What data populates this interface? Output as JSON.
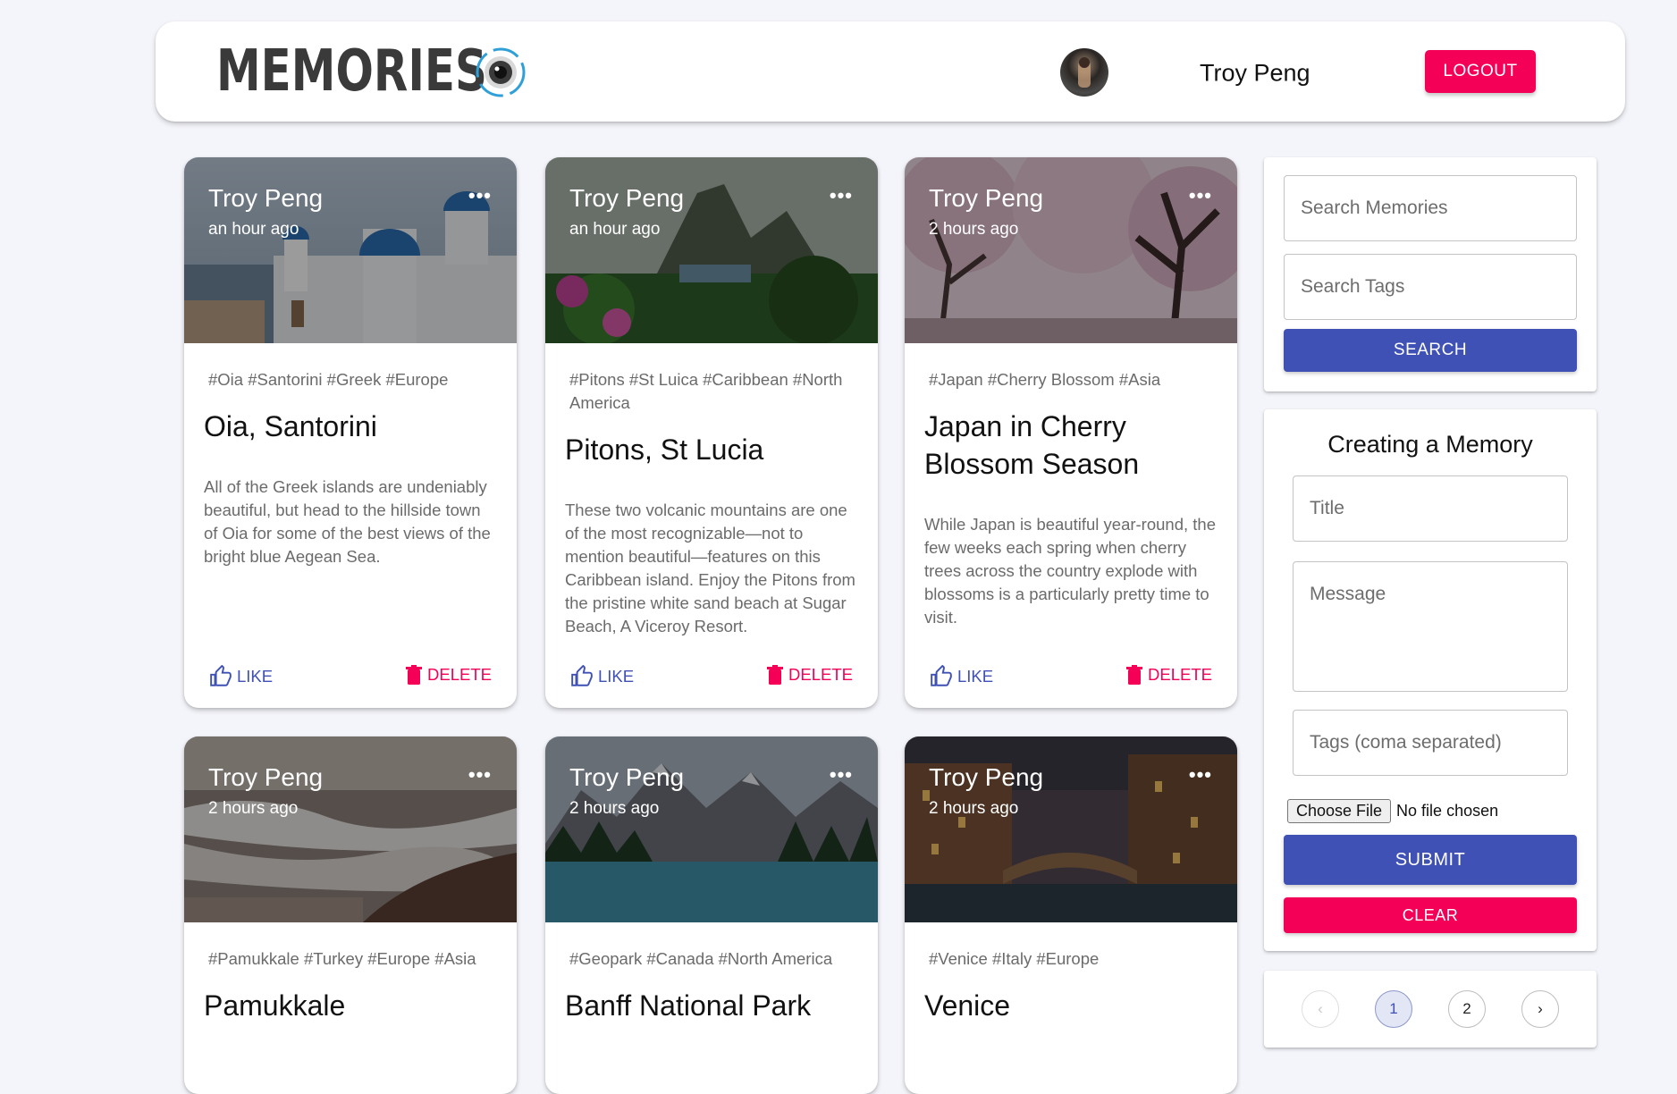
{
  "header": {
    "brand": "MEMORIES",
    "logo_icon": "camera-lens-icon",
    "username": "Troy Peng",
    "logout_label": "LOGOUT"
  },
  "colors": {
    "primary": "#3f51b5",
    "secondary": "#f50057",
    "background": "#f4f5fa"
  },
  "posts": [
    {
      "author": "Troy Peng",
      "time": "an hour ago",
      "more": "•••",
      "tags": "#Oia #Santorini #Greek #Europe",
      "title": "Oia, Santorini",
      "message": "All of the Greek islands are undeniably beautiful, but head to the hillside town of Oia for some of the best views of the bright blue Aegean Sea.",
      "like_label": "LIKE",
      "delete_label": "DELETE",
      "image": "santorini-photo"
    },
    {
      "author": "Troy Peng",
      "time": "an hour ago",
      "more": "•••",
      "tags": "#Pitons #St Luica #Caribbean #North America",
      "title": "Pitons, St Lucia",
      "message": "These two volcanic mountains are one of the most recognizable—not to mention beautiful—features on this Caribbean island. Enjoy the Pitons from the pristine white sand beach at Sugar Beach, A Viceroy Resort.",
      "like_label": "LIKE",
      "delete_label": "DELETE",
      "image": "pitons-photo"
    },
    {
      "author": "Troy Peng",
      "time": "2 hours ago",
      "more": "•••",
      "tags": "#Japan #Cherry Blossom #Asia",
      "title": "Japan in Cherry Blossom Season",
      "message": "While Japan is beautiful year-round, the few weeks each spring when cherry trees across the country explode with blossoms is a particularly pretty time to visit.",
      "like_label": "LIKE",
      "delete_label": "DELETE",
      "image": "cherry-blossom-photo"
    },
    {
      "author": "Troy Peng",
      "time": "2 hours ago",
      "more": "•••",
      "tags": "#Pamukkale #Turkey #Europe #Asia",
      "title": "Pamukkale",
      "message": "",
      "like_label": "",
      "delete_label": "",
      "image": "pamukkale-photo"
    },
    {
      "author": "Troy Peng",
      "time": "2 hours ago",
      "more": "•••",
      "tags": "#Geopark #Canada #North America",
      "title": "Banff National Park",
      "message": "",
      "like_label": "",
      "delete_label": "",
      "image": "banff-photo"
    },
    {
      "author": "Troy Peng",
      "time": "2 hours ago",
      "more": "•••",
      "tags": "#Venice #Italy #Europe",
      "title": "Venice",
      "message": "",
      "like_label": "",
      "delete_label": "",
      "image": "venice-photo"
    }
  ],
  "search": {
    "memories_placeholder": "Search Memories",
    "tags_placeholder": "Search Tags",
    "button_label": "SEARCH"
  },
  "form": {
    "title": "Creating a Memory",
    "title_placeholder": "Title",
    "message_placeholder": "Message",
    "tags_placeholder": "Tags (coma separated)",
    "file_button": "Choose File",
    "file_status": "No file chosen",
    "submit_label": "SUBMIT",
    "clear_label": "CLEAR"
  },
  "pagination": {
    "prev": "‹",
    "pages": [
      "1",
      "2"
    ],
    "current": "1",
    "next": "›"
  }
}
